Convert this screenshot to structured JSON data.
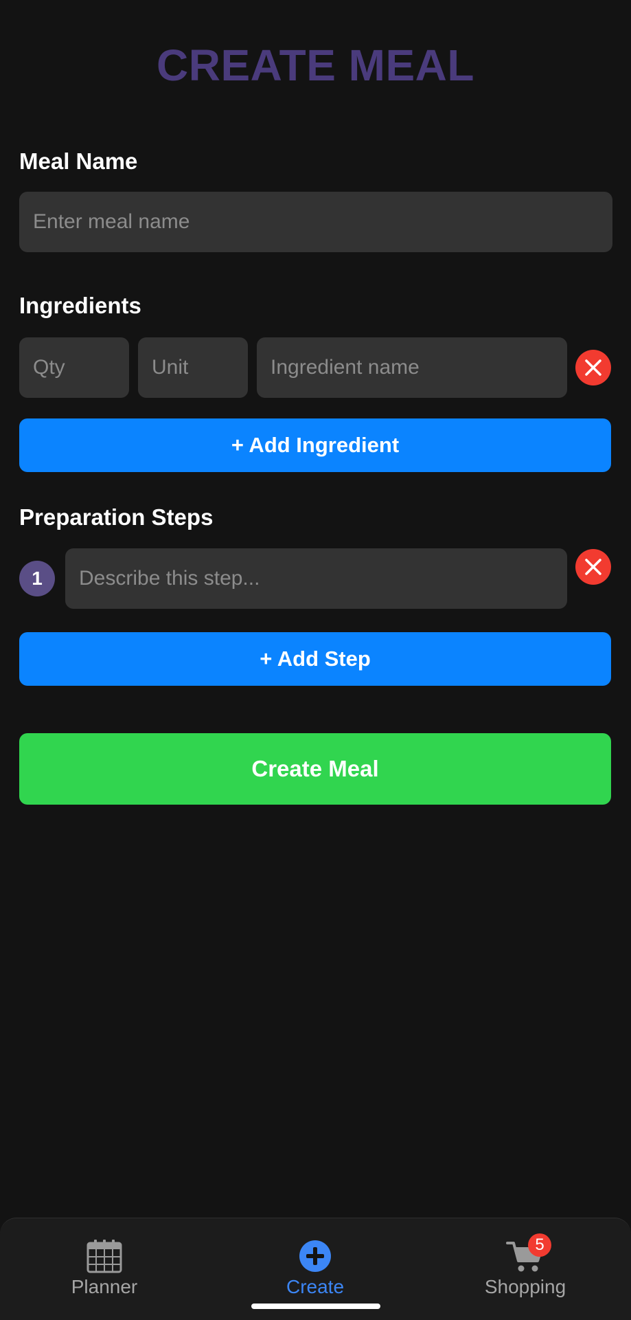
{
  "header": {
    "title": "CREATE MEAL"
  },
  "meal_name": {
    "label": "Meal Name",
    "placeholder": "Enter meal name",
    "value": ""
  },
  "ingredients": {
    "label": "Ingredients",
    "rows": [
      {
        "qty_placeholder": "Qty",
        "unit_placeholder": "Unit",
        "name_placeholder": "Ingredient name"
      }
    ],
    "add_label": "+ Add Ingredient"
  },
  "steps": {
    "label": "Preparation Steps",
    "rows": [
      {
        "number": "1",
        "placeholder": "Describe this step..."
      }
    ],
    "add_label": "+ Add Step"
  },
  "submit": {
    "label": "Create Meal"
  },
  "tabbar": {
    "tabs": [
      {
        "label": "Planner",
        "icon": "calendar-icon",
        "active": false
      },
      {
        "label": "Create",
        "icon": "plus-circle-icon",
        "active": true
      },
      {
        "label": "Shopping",
        "icon": "cart-icon",
        "active": false,
        "badge": "5"
      }
    ]
  },
  "colors": {
    "background": "#131313",
    "title": "#4a3b7c",
    "field": "#333333",
    "primary_blue": "#0b84ff",
    "success_green": "#31d54f",
    "danger_red": "#f23b30",
    "step_badge": "#5a4e86",
    "active_tab": "#3c86f5"
  }
}
